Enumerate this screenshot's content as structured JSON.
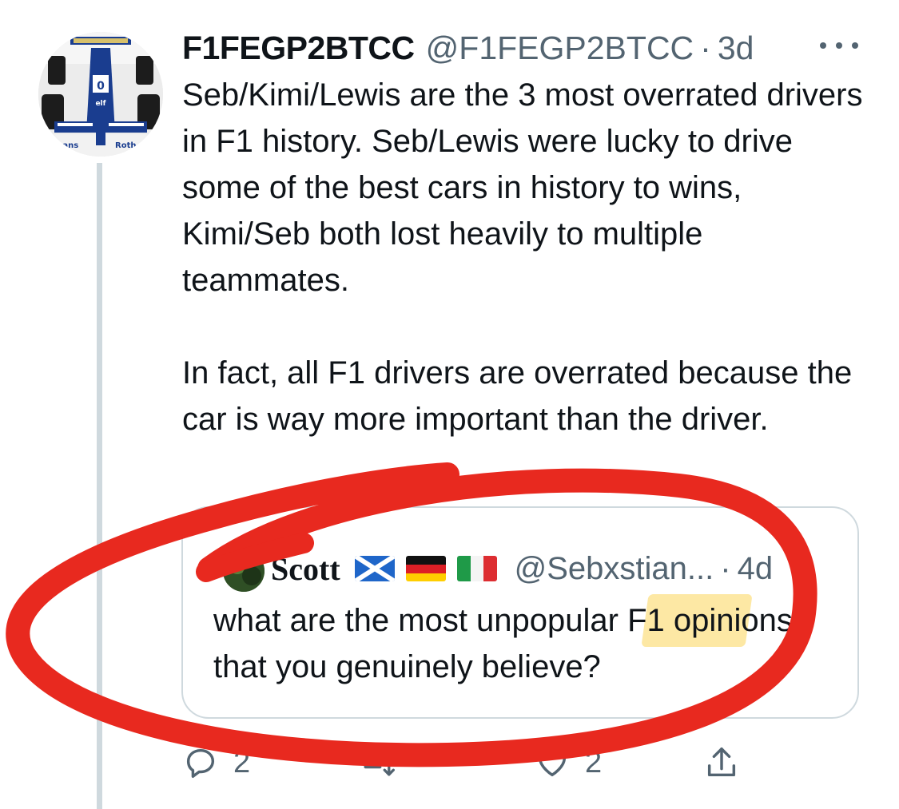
{
  "tweet": {
    "display_name": "F1FEGP2BTCC",
    "handle": "@F1FEGP2BTCC",
    "separator": "·",
    "time": "3d",
    "paragraphs": [
      "Seb/Kimi/Lewis are the 3 most overrated drivers in F1 history. Seb/Lewis were lucky to drive some of the best cars in history to wins, Kimi/Seb both lost heavily to multiple teammates.",
      "In fact, all F1 drivers are overrated because the car is way more important than the driver."
    ]
  },
  "quote": {
    "display_name": "Scott",
    "flags": [
      "scotland-flag",
      "germany-flag",
      "italy-flag"
    ],
    "handle": "@Sebxstian...",
    "separator": "·",
    "time": "4d",
    "text": "what are the most unpopular F1 opinions that you genuinely believe?"
  },
  "actions": {
    "reply_count": "2",
    "retweet_count": "",
    "like_count": "2"
  },
  "icons": {
    "more": "more-horizontal-icon",
    "reply": "reply-icon",
    "retweet": "retweet-icon",
    "like": "heart-icon",
    "share": "share-icon"
  },
  "colors": {
    "annotation_red": "#e8291f",
    "highlight_yellow": "#fcd65a",
    "secondary_text": "#536471",
    "border": "#cfd9de"
  }
}
